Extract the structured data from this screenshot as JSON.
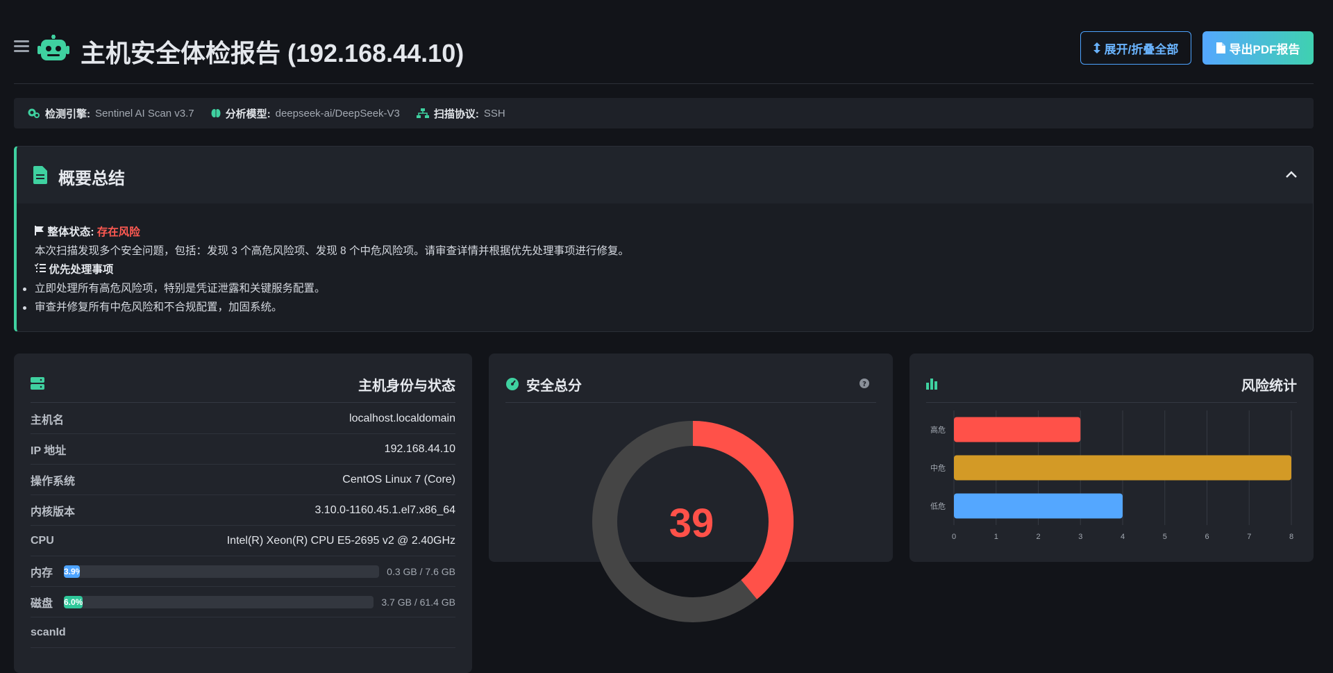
{
  "header": {
    "title": "主机安全体检报告 (192.168.44.10)",
    "toggle_label": "展开/折叠全部",
    "export_label": "导出PDF报告"
  },
  "infobar": [
    {
      "key": "检测引擎:",
      "value": "Sentinel AI Scan v3.7",
      "icon": "cogs-icon"
    },
    {
      "key": "分析模型:",
      "value": "deepseek-ai/DeepSeek-V3",
      "icon": "brain-icon"
    },
    {
      "key": "扫描协议:",
      "value": "SSH",
      "icon": "network-icon"
    }
  ],
  "summary": {
    "title": "概要总结",
    "status_label": "整体状态:",
    "status_value": "存在风险",
    "description": "本次扫描发现多个安全问题，包括：发现 3 个高危风险项、发现 8 个中危风险项。请审查详情并根据优先处理事项进行修复。",
    "priority_title": "优先处理事项",
    "priorities": [
      "立即处理所有高危风险项，特别是凭证泄露和关键服务配置。",
      "审查并修复所有中危风险和不合规配置，加固系统。"
    ]
  },
  "host": {
    "title": "主机身份与状态",
    "rows": [
      {
        "label": "主机名",
        "value": "localhost.localdomain"
      },
      {
        "label": "IP 地址",
        "value": "192.168.44.10"
      },
      {
        "label": "操作系统",
        "value": "CentOS Linux 7 (Core)"
      },
      {
        "label": "内核版本",
        "value": "3.10.0-1160.45.1.el7.x86_64"
      },
      {
        "label": "CPU",
        "value": "Intel(R) Xeon(R) CPU E5-2695 v2 @ 2.40GHz"
      }
    ],
    "memory": {
      "label": "内存",
      "percent_text": "3.9%",
      "percent": 3.9,
      "caption": "0.3 GB / 7.6 GB",
      "color": "#4da3ff"
    },
    "disk": {
      "label": "磁盘",
      "percent_text": "6.0%",
      "percent": 6.0,
      "caption": "3.7 GB / 61.4 GB",
      "color": "#2fc79a"
    },
    "scan_label": "scanId"
  },
  "score": {
    "title": "安全总分",
    "value": "39",
    "score": 39,
    "max": 100,
    "color": "#ff5149",
    "track_color": "#454545"
  },
  "risk": {
    "title": "风险统计"
  },
  "chart_data": {
    "type": "bar",
    "orientation": "horizontal",
    "categories": [
      "高危",
      "中危",
      "低危"
    ],
    "values": [
      3,
      8,
      4
    ],
    "colors": [
      "#ff5149",
      "#d39a26",
      "#54a7ff"
    ],
    "xlim": [
      0,
      8
    ],
    "xticks": [
      0,
      1,
      2,
      3,
      4,
      5,
      6,
      7,
      8
    ],
    "grid": true,
    "title": "风险统计"
  }
}
